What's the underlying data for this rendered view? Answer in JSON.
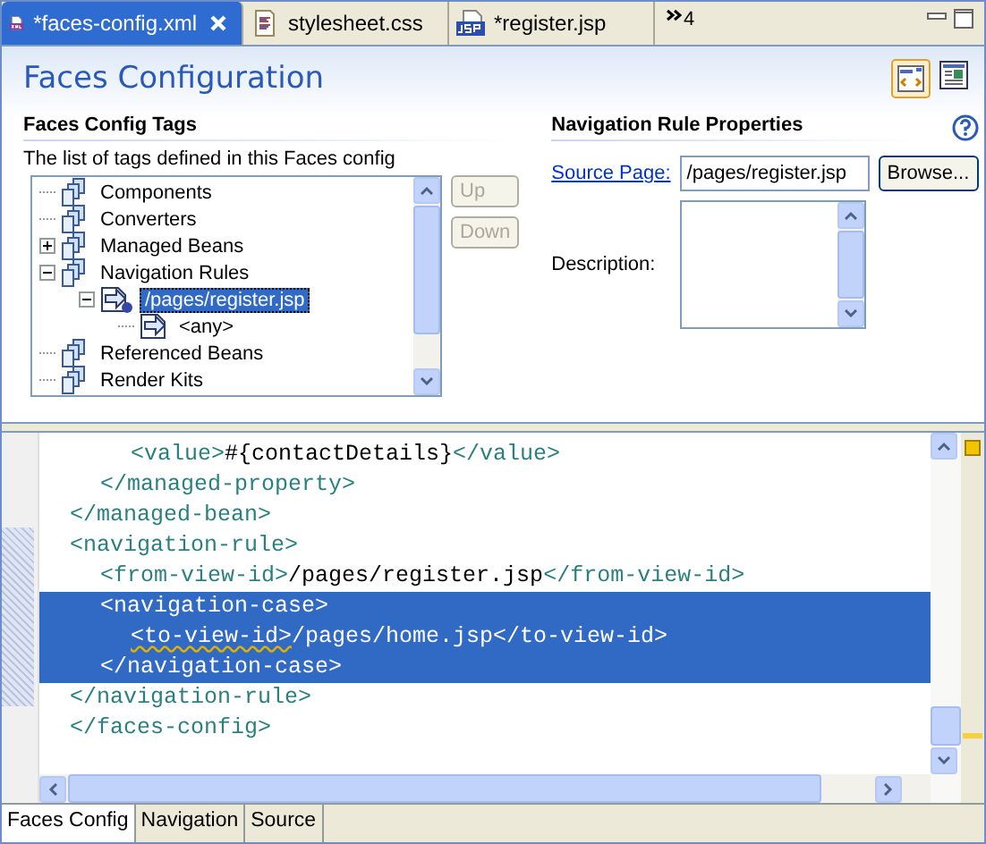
{
  "editor_tabs": [
    {
      "label": "*faces-config.xml",
      "kind": "xml",
      "selected": true
    },
    {
      "label": "stylesheet.css",
      "kind": "css",
      "selected": false
    },
    {
      "label": "*register.jsp",
      "kind": "jsp",
      "selected": false
    }
  ],
  "overflow_count": "4",
  "form": {
    "title": "Faces Configuration",
    "tags_section": {
      "title": "Faces Config Tags",
      "description": "The list of tags defined in this Faces config",
      "tree": [
        {
          "label": "Components",
          "kind": "category",
          "selected": false
        },
        {
          "label": "Converters",
          "kind": "category",
          "selected": false
        },
        {
          "label": "Managed Beans",
          "kind": "category",
          "expanded": false,
          "selected": false
        },
        {
          "label": "Navigation Rules",
          "kind": "category",
          "expanded": true,
          "selected": false,
          "children": [
            {
              "label": "/pages/register.jsp",
              "kind": "rule",
              "expanded": true,
              "selected": true,
              "children": [
                {
                  "label": "<any>",
                  "kind": "case",
                  "selected": false
                }
              ]
            }
          ]
        },
        {
          "label": "Referenced Beans",
          "kind": "category",
          "selected": false
        },
        {
          "label": "Render Kits",
          "kind": "category",
          "selected": false
        }
      ],
      "buttons": [
        {
          "label": "Up",
          "disabled": true
        },
        {
          "label": "Down",
          "disabled": true
        }
      ]
    },
    "properties_section": {
      "title": "Navigation Rule Properties",
      "source_page_link": "Source Page:",
      "source_page_value": "/pages/register.jsp",
      "browse_button": "Browse...",
      "description_label": "Description:"
    }
  },
  "source": {
    "lines": [
      {
        "children": [
          {
            "children": [
              {
                "children": [
                  {
                    "selected": false,
                    "segments": [
                      {
                        "kind": "tag",
                        "text": "<value>",
                        "warning": false
                      },
                      {
                        "kind": "text",
                        "text": "#{contactDetails}",
                        "warning": false
                      },
                      {
                        "kind": "tag",
                        "text": "</value>",
                        "warning": false
                      }
                    ]
                  }
                ]
              },
              {
                "selected": false,
                "segments": [
                  {
                    "kind": "tag",
                    "text": "</managed-property>",
                    "warning": false
                  }
                ]
              }
            ]
          },
          {
            "selected": false,
            "segments": [
              {
                "kind": "tag",
                "text": "</managed-bean>",
                "warning": false
              }
            ]
          },
          {
            "selected": false,
            "segments": [
              {
                "kind": "tag",
                "text": "<navigation-rule>",
                "warning": false
              }
            ],
            "children": [
              {
                "selected": false,
                "segments": [
                  {
                    "kind": "tag",
                    "text": "<from-view-id>",
                    "warning": false
                  },
                  {
                    "kind": "text",
                    "text": "/pages/register.jsp",
                    "warning": false
                  },
                  {
                    "kind": "tag",
                    "text": "</from-view-id>",
                    "warning": false
                  }
                ]
              },
              {
                "selected": true,
                "segments": [
                  {
                    "kind": "tag",
                    "text": "<navigation-case>",
                    "warning": false
                  }
                ],
                "children": [
                  {
                    "selected": true,
                    "segments": [
                      {
                        "kind": "tag",
                        "text": "<to-view-id>",
                        "warning": true
                      },
                      {
                        "kind": "text",
                        "text": "/pages/home.jsp",
                        "warning": false
                      },
                      {
                        "kind": "tag",
                        "text": "</to-view-id>",
                        "warning": false
                      }
                    ]
                  }
                ]
              },
              {
                "selected": true,
                "segments": [
                  {
                    "kind": "tag",
                    "text": "</navigation-case>",
                    "warning": false
                  }
                ]
              }
            ]
          },
          {
            "selected": false,
            "segments": [
              {
                "kind": "tag",
                "text": "</navigation-rule>",
                "warning": false
              }
            ]
          },
          {
            "selected": false,
            "segments": [
              {
                "kind": "tag",
                "text": "</faces-config>",
                "warning": false
              }
            ]
          }
        ]
      }
    ]
  },
  "bottom_tabs": [
    {
      "label": "Faces Config",
      "selected": true
    },
    {
      "label": "Navigation",
      "selected": false
    },
    {
      "label": "Source",
      "selected": false
    }
  ]
}
